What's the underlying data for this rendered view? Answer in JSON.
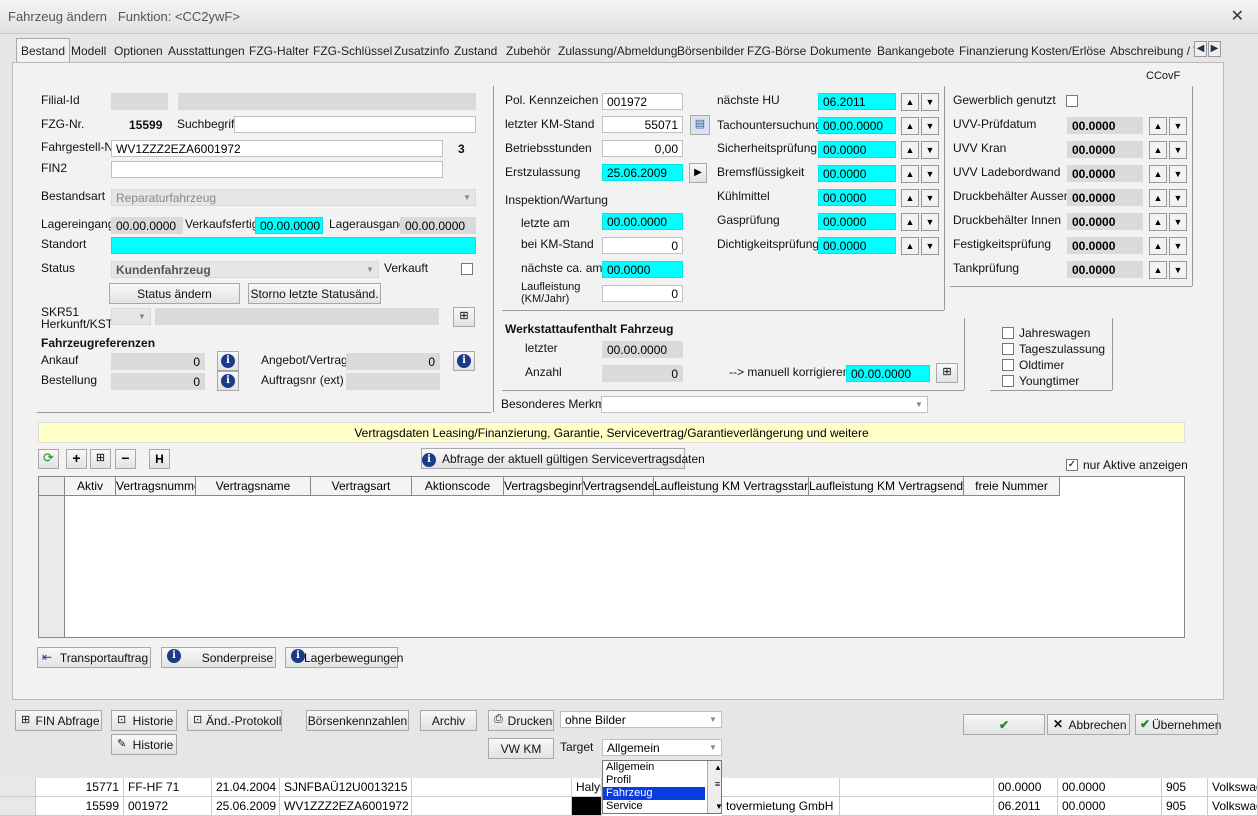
{
  "window": {
    "title": "Fahrzeug ändern",
    "funktion": "Funktion: <CC2ywF>"
  },
  "tabs": [
    "Bestand",
    "Modell",
    "Optionen",
    "Ausstattungen",
    "FZG-Halter",
    "FZG-Schlüssel",
    "Zusatzinfo",
    "Zustand",
    "Zubehör",
    "Zulassung/Abmeldung",
    "Börsenbilder",
    "FZG-Börse",
    "Dokumente",
    "Bankangebote",
    "Finanzierung",
    "Kosten/Erlöse",
    "Abschreibung / \\"
  ],
  "ccovf": "CCovF",
  "left": {
    "filial_label": "Filial-Id",
    "fzgnr_label": "FZG-Nr.",
    "fzgnr": "15599",
    "suchbegriff_label": "Suchbegriff",
    "fahrgestell_label": "Fahrgestell-Nr",
    "fahrgestell": "WV1ZZZ2EZA6001972",
    "fahrgestell_count": "3",
    "fin2_label": "FIN2",
    "bestandsart_label": "Bestandsart",
    "bestandsart": "Reparaturfahrzeug",
    "lagereingang_label": "Lagereingang",
    "lagereingang": "00.00.0000",
    "verkaufsfertig_label": "Verkaufsfertig",
    "verkaufsfertig": "00.00.0000",
    "lagerausgang_label": "Lagerausgang",
    "lagerausgang": "00.00.0000",
    "standort_label": "Standort",
    "status_label": "Status",
    "status": "Kundenfahrzeug",
    "verkauft_label": "Verkauft",
    "status_btn": "Status ändern",
    "storno_btn": "Storno letzte Statusänd.",
    "skr_label1": "SKR51",
    "skr_label2": "Herkunft/KST",
    "refs_title": "Fahrzeugreferenzen",
    "ankauf_label": "Ankauf",
    "ankauf": "0",
    "bestellung_label": "Bestellung",
    "bestellung": "0",
    "angebot_label": "Angebot/Vertrag",
    "angebot": "0",
    "auftragsnr_label": "Auftragsnr (ext)"
  },
  "mid": {
    "kennzeichen_label": "Pol. Kennzeichen",
    "kennzeichen": "001972",
    "km_label": "letzter KM-Stand",
    "km": "55071",
    "betriebsstunden_label": "Betriebsstunden",
    "betriebsstunden": "0,00",
    "erstzulassung_label": "Erstzulassung",
    "erstzulassung": "25.06.2009",
    "inspektion_label": "Inspektion/Wartung",
    "letzte_am_label": "letzte am",
    "letzte_am": "00.00.0000",
    "bei_km_label": "bei KM-Stand",
    "bei_km": "0",
    "naechste_label": "nächste ca. am",
    "naechste": "00.0000",
    "laufleistung_label1": "Laufleistung",
    "laufleistung_label2": "(KM/Jahr)",
    "laufleistung": "0",
    "werkstatt_title": "Werkstattaufenthalt Fahrzeug",
    "letzter_label": "letzter",
    "letzter": "00.00.0000",
    "anzahl_label": "Anzahl",
    "anzahl": "0",
    "manuell_label": "--> manuell korrigieren in",
    "manuell": "00.00.0000",
    "merkmal_label": "Besonderes Merkmal"
  },
  "hu": [
    {
      "label": "nächste HU",
      "value": "06.2011"
    },
    {
      "label": "Tachountersuchung",
      "value": "00.00.0000"
    },
    {
      "label": "Sicherheitsprüfung",
      "value": "00.0000"
    },
    {
      "label": "Bremsflüssigkeit",
      "value": "00.0000"
    },
    {
      "label": "Kühlmittel",
      "value": "00.0000"
    },
    {
      "label": "Gasprüfung",
      "value": "00.0000"
    },
    {
      "label": "Dichtigkeitsprüfung",
      "value": "00.0000"
    }
  ],
  "right": {
    "gewerblich_label": "Gewerblich genutzt",
    "items": [
      {
        "label": "UVV-Prüfdatum",
        "value": "00.0000"
      },
      {
        "label": "UVV Kran",
        "value": "00.0000"
      },
      {
        "label": "UVV Ladebordwand",
        "value": "00.0000"
      },
      {
        "label": "Druckbehälter Aussen",
        "value": "00.0000"
      },
      {
        "label": "Druckbehälter Innen",
        "value": "00.0000"
      },
      {
        "label": "Festigkeitsprüfung",
        "value": "00.0000"
      },
      {
        "label": "Tankprüfung",
        "value": "00.0000"
      }
    ],
    "checks": [
      "Jahreswagen",
      "Tageszulassung",
      "Oldtimer",
      "Youngtimer"
    ]
  },
  "contracts": {
    "banner": "Vertragsdaten Leasing/Finanzierung, Garantie, Servicevertrag/Garantieverlängerung und weitere",
    "abfrage_btn": "Abfrage der aktuell gültigen Servicevertragsdaten",
    "nur_aktive": "nur Aktive anzeigen",
    "h_btn": "H",
    "columns": [
      "Aktiv",
      "Vertragsnummer",
      "Vertragsname",
      "Vertragsart",
      "Aktionscode",
      "Vertragsbeginn",
      "Vertragsende",
      "Laufleistung KM Vertragsstart",
      "Laufleistung KM Vertragsende",
      "freie Nummer"
    ]
  },
  "panel_buttons": {
    "transport": "Transportauftrag",
    "sonderpreise": "Sonderpreise",
    "lager": "Lagerbewegungen"
  },
  "footer": {
    "fin_abfrage": "FIN Abfrage",
    "historie1": "Historie",
    "historie2": "Historie",
    "aend_protokoll": "Änd.-Protokoll",
    "boersen": "Börsenkennzahlen",
    "archiv": "Archiv",
    "drucken": "Drucken",
    "vwkm": "VW KM",
    "bilder": "ohne Bilder",
    "target_label": "Target",
    "target": "Allgemein",
    "options": [
      "Allgemein",
      "Profil",
      "Fahrzeug",
      "Service"
    ],
    "abbrechen": "Abbrechen",
    "uebernehmen": "Übernehmen"
  },
  "bg_rows": [
    [
      "15771",
      "FF-HF 71",
      "21.04.2004",
      "SJNFBAÜ12U0013215",
      "Halyn",
      "",
      "00.0000",
      "00.0000",
      "905",
      "Volkswag"
    ],
    [
      "15599",
      "001972",
      "25.06.2009",
      "WV1ZZZ2EZA6001972",
      "tovermietung GmbH",
      "",
      "06.2011",
      "00.0000",
      "905",
      "Volkswag"
    ]
  ],
  "colors": {
    "cyan": "#00ffff",
    "banner": "#ffffc8",
    "selection": "#0a3de0"
  }
}
